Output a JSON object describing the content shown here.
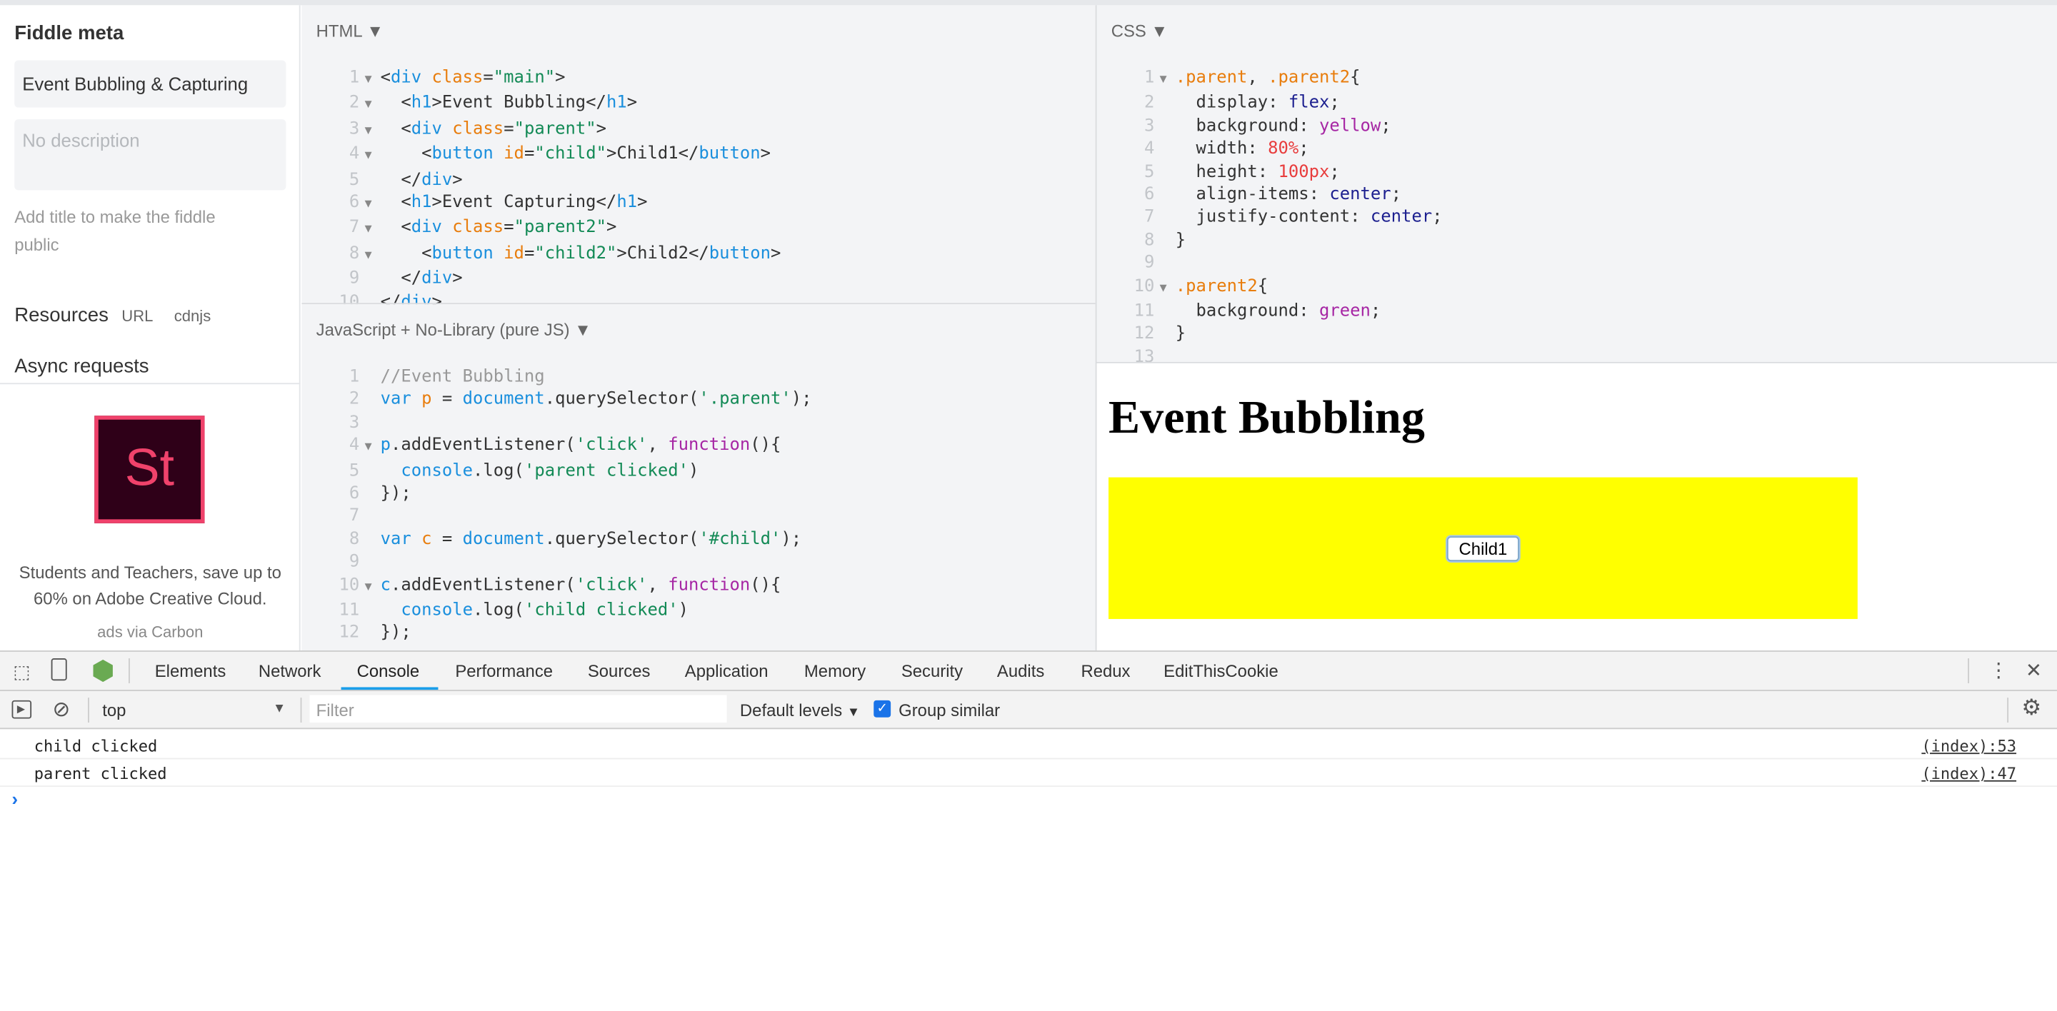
{
  "sidebar": {
    "title": "Fiddle meta",
    "title_value": "Event Bubbling & Capturing",
    "description_placeholder": "No description",
    "hint": "Add title to make the fiddle public",
    "resources": "Resources",
    "resources_url": "URL",
    "resources_cdnjs": "cdnjs",
    "async": "Async requests",
    "ad": {
      "logo": "St",
      "text": "Students and Teachers, save up to 60% on Adobe Creative Cloud.",
      "via": "ads via Carbon"
    }
  },
  "html_panel": {
    "label": "HTML",
    "lines": [
      {
        "fold": true,
        "t": [
          [
            "<",
            "txt"
          ],
          [
            "div",
            "tag"
          ],
          [
            " class",
            "attr"
          ],
          [
            "=",
            "txt"
          ],
          [
            "\"main\"",
            "str"
          ],
          [
            ">",
            "txt"
          ]
        ]
      },
      {
        "fold": true,
        "t": [
          [
            "  <",
            "txt"
          ],
          [
            "h1",
            "tag"
          ],
          [
            ">Event Bubbling</",
            "txt"
          ],
          [
            "h1",
            "tag"
          ],
          [
            ">",
            "txt"
          ]
        ]
      },
      {
        "fold": true,
        "t": [
          [
            "  <",
            "txt"
          ],
          [
            "div",
            "tag"
          ],
          [
            " class",
            "attr"
          ],
          [
            "=",
            "txt"
          ],
          [
            "\"parent\"",
            "str"
          ],
          [
            ">",
            "txt"
          ]
        ]
      },
      {
        "fold": true,
        "t": [
          [
            "    <",
            "txt"
          ],
          [
            "button",
            "tag"
          ],
          [
            " id",
            "attr"
          ],
          [
            "=",
            "txt"
          ],
          [
            "\"child\"",
            "str"
          ],
          [
            ">Child1</",
            "txt"
          ],
          [
            "button",
            "tag"
          ],
          [
            ">",
            "txt"
          ]
        ]
      },
      {
        "fold": false,
        "t": [
          [
            "  </",
            "txt"
          ],
          [
            "div",
            "tag"
          ],
          [
            ">",
            "txt"
          ]
        ]
      },
      {
        "fold": true,
        "t": [
          [
            "  <",
            "txt"
          ],
          [
            "h1",
            "tag"
          ],
          [
            ">Event Capturing</",
            "txt"
          ],
          [
            "h1",
            "tag"
          ],
          [
            ">",
            "txt"
          ]
        ]
      },
      {
        "fold": true,
        "t": [
          [
            "  <",
            "txt"
          ],
          [
            "div",
            "tag"
          ],
          [
            " class",
            "attr"
          ],
          [
            "=",
            "txt"
          ],
          [
            "\"parent2\"",
            "str"
          ],
          [
            ">",
            "txt"
          ]
        ]
      },
      {
        "fold": true,
        "t": [
          [
            "    <",
            "txt"
          ],
          [
            "button",
            "tag"
          ],
          [
            " id",
            "attr"
          ],
          [
            "=",
            "txt"
          ],
          [
            "\"child2\"",
            "str"
          ],
          [
            ">Child2</",
            "txt"
          ],
          [
            "button",
            "tag"
          ],
          [
            ">",
            "txt"
          ]
        ]
      },
      {
        "fold": false,
        "t": [
          [
            "  </",
            "txt"
          ],
          [
            "div",
            "tag"
          ],
          [
            ">",
            "txt"
          ]
        ]
      },
      {
        "fold": false,
        "t": [
          [
            "</",
            "txt"
          ],
          [
            "div",
            "tag"
          ],
          [
            ">",
            "txt"
          ]
        ]
      }
    ]
  },
  "js_panel": {
    "label": "JavaScript + No-Library (pure JS)",
    "lines": [
      {
        "fold": false,
        "t": [
          [
            "//Event Bubbling",
            "com"
          ]
        ]
      },
      {
        "fold": false,
        "t": [
          [
            "var",
            "kw"
          ],
          [
            " ",
            "txt"
          ],
          [
            "p",
            "var"
          ],
          [
            " = ",
            "txt"
          ],
          [
            "document",
            "obj"
          ],
          [
            ".querySelector(",
            "txt"
          ],
          [
            "'.parent'",
            "str"
          ],
          [
            ");",
            "txt"
          ]
        ]
      },
      {
        "fold": false,
        "t": []
      },
      {
        "fold": true,
        "t": [
          [
            "p",
            "obj"
          ],
          [
            ".addEventListener(",
            "txt"
          ],
          [
            "'click'",
            "str"
          ],
          [
            ", ",
            "txt"
          ],
          [
            "function",
            "fn"
          ],
          [
            "(){",
            "txt"
          ]
        ]
      },
      {
        "fold": false,
        "t": [
          [
            "  ",
            "txt"
          ],
          [
            "console",
            "obj"
          ],
          [
            ".log(",
            "txt"
          ],
          [
            "'parent clicked'",
            "str"
          ],
          [
            ")",
            "txt"
          ]
        ]
      },
      {
        "fold": false,
        "t": [
          [
            "});",
            "txt"
          ]
        ]
      },
      {
        "fold": false,
        "t": []
      },
      {
        "fold": false,
        "t": [
          [
            "var",
            "kw"
          ],
          [
            " ",
            "txt"
          ],
          [
            "c",
            "var"
          ],
          [
            " = ",
            "txt"
          ],
          [
            "document",
            "obj"
          ],
          [
            ".querySelector(",
            "txt"
          ],
          [
            "'#child'",
            "str"
          ],
          [
            ");",
            "txt"
          ]
        ]
      },
      {
        "fold": false,
        "t": []
      },
      {
        "fold": true,
        "t": [
          [
            "c",
            "obj"
          ],
          [
            ".addEventListener(",
            "txt"
          ],
          [
            "'click'",
            "str"
          ],
          [
            ", ",
            "txt"
          ],
          [
            "function",
            "fn"
          ],
          [
            "(){",
            "txt"
          ]
        ]
      },
      {
        "fold": false,
        "t": [
          [
            "  ",
            "txt"
          ],
          [
            "console",
            "obj"
          ],
          [
            ".log(",
            "txt"
          ],
          [
            "'child clicked'",
            "str"
          ],
          [
            ")",
            "txt"
          ]
        ]
      },
      {
        "fold": false,
        "t": [
          [
            "});",
            "txt"
          ]
        ]
      }
    ]
  },
  "css_panel": {
    "label": "CSS",
    "lines": [
      {
        "fold": true,
        "t": [
          [
            ".parent",
            "sel"
          ],
          [
            ", ",
            "txt"
          ],
          [
            ".parent2",
            "sel"
          ],
          [
            "{",
            "txt"
          ]
        ]
      },
      {
        "fold": false,
        "t": [
          [
            "  display: ",
            "prop"
          ],
          [
            "flex",
            "val"
          ],
          [
            ";",
            "txt"
          ]
        ]
      },
      {
        "fold": false,
        "t": [
          [
            "  background: ",
            "prop"
          ],
          [
            "yellow",
            "col"
          ],
          [
            ";",
            "txt"
          ]
        ]
      },
      {
        "fold": false,
        "t": [
          [
            "  width: ",
            "prop"
          ],
          [
            "80%",
            "num"
          ],
          [
            ";",
            "txt"
          ]
        ]
      },
      {
        "fold": false,
        "t": [
          [
            "  height: ",
            "prop"
          ],
          [
            "100px",
            "num"
          ],
          [
            ";",
            "txt"
          ]
        ]
      },
      {
        "fold": false,
        "t": [
          [
            "  align-items: ",
            "prop"
          ],
          [
            "center",
            "val"
          ],
          [
            ";",
            "txt"
          ]
        ]
      },
      {
        "fold": false,
        "t": [
          [
            "  justify-content: ",
            "prop"
          ],
          [
            "center",
            "val"
          ],
          [
            ";",
            "txt"
          ]
        ]
      },
      {
        "fold": false,
        "t": [
          [
            "}",
            "txt"
          ]
        ]
      },
      {
        "fold": false,
        "t": []
      },
      {
        "fold": true,
        "t": [
          [
            ".parent2",
            "sel"
          ],
          [
            "{",
            "txt"
          ]
        ]
      },
      {
        "fold": false,
        "t": [
          [
            "  background: ",
            "prop"
          ],
          [
            "green",
            "col"
          ],
          [
            ";",
            "txt"
          ]
        ]
      },
      {
        "fold": false,
        "t": [
          [
            "}",
            "txt"
          ]
        ]
      },
      {
        "fold": false,
        "t": []
      }
    ]
  },
  "result": {
    "heading": "Event Bubbling",
    "button": "Child1",
    "box_color": "#ffff00"
  },
  "devtools": {
    "tabs": [
      "Elements",
      "Network",
      "Console",
      "Performance",
      "Sources",
      "Application",
      "Memory",
      "Security",
      "Audits",
      "Redux",
      "EditThisCookie"
    ],
    "active_tab": "Console",
    "context": "top",
    "filter_placeholder": "Filter",
    "levels": "Default levels",
    "group_similar": "Group similar",
    "group_similar_checked": true,
    "messages": [
      {
        "text": "child clicked",
        "source": "(index):53"
      },
      {
        "text": "parent clicked",
        "source": "(index):47"
      }
    ],
    "prompt": "›",
    "accent": "#1a9ee9"
  }
}
